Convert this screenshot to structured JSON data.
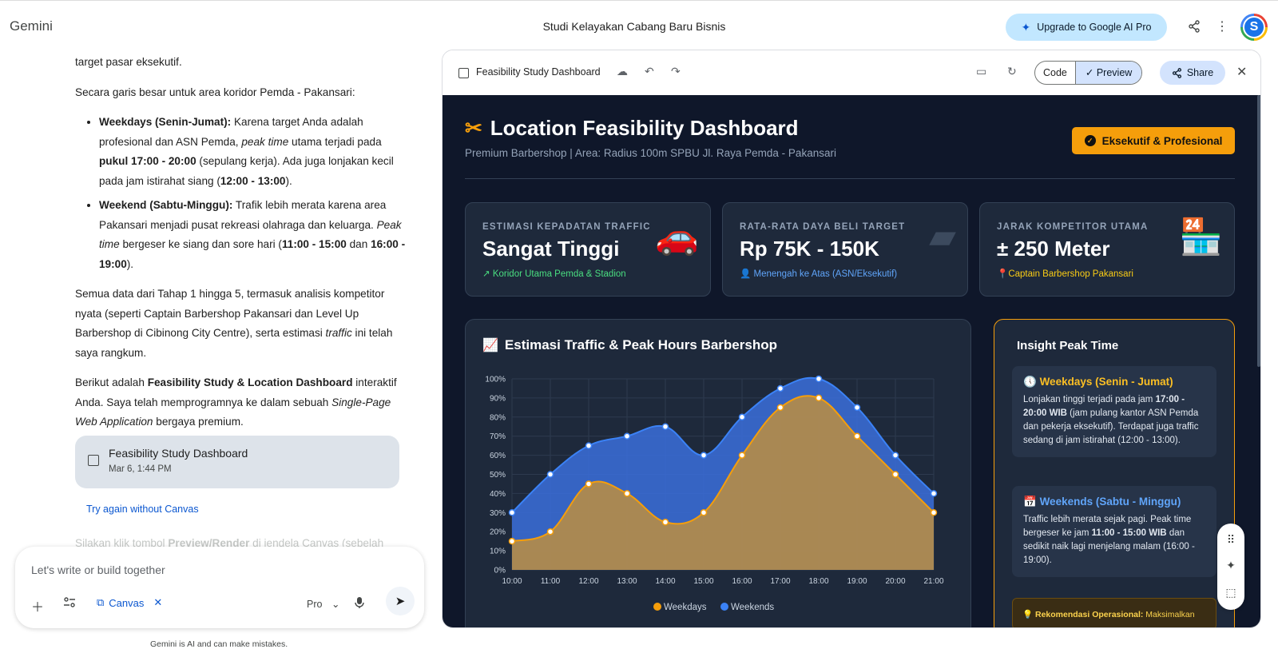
{
  "app": {
    "name": "Gemini",
    "conversation_title": "Studi Kelayakan Cabang Baru Bisnis",
    "upgrade_label": "Upgrade to Google AI Pro",
    "avatar_letter": "S"
  },
  "chat": {
    "p0": "target pasar eksekutif.",
    "p1": "Secara garis besar untuk area koridor Pemda - Pakansari:",
    "b1": {
      "title": "Weekdays (Senin-Jumat):",
      "t1": " Karena target Anda adalah profesional dan ASN Pemda, ",
      "i1": "peak time",
      "t2": " utama terjadi pada ",
      "b": "pukul 17:00 - 20:00",
      "t3": " (sepulang kerja). Ada juga lonjakan kecil pada jam istirahat siang (",
      "b2": "12:00 - 13:00",
      "t4": ")."
    },
    "b2": {
      "title": "Weekend (Sabtu-Minggu):",
      "t1": " Trafik lebih merata karena area Pakansari menjadi pusat rekreasi olahraga dan keluarga. ",
      "i1": "Peak time",
      "t2": " bergeser ke siang dan sore hari (",
      "b": "11:00 - 15:00",
      "t3": " dan ",
      "b2": "16:00 - 19:00",
      "t4": ")."
    },
    "p2": {
      "t1": "Semua data dari Tahap 1 hingga 5, termasuk analisis kompetitor nyata (seperti Captain Barbershop Pakansari dan Level Up Barbershop di Cibinong City Centre), serta estimasi ",
      "i": "traffic",
      "t2": " ini telah saya rangkum."
    },
    "p3": {
      "t1": "Berikut adalah ",
      "b": "Feasibility Study & Location Dashboard",
      "t2": " interaktif Anda. Saya telah memprogramnya ke dalam sebuah ",
      "i": "Single-Page Web Application",
      "t3": " bergaya premium."
    },
    "card_title": "Feasibility Study Dashboard",
    "card_date": "Mar 6, 1:44 PM",
    "try_again": "Try again without Canvas",
    "faded": {
      "t1": "Silakan klik tombol ",
      "b": "Preview/Render",
      "t2": " di jendela Canvas (sebelah"
    }
  },
  "composer": {
    "placeholder": "Let's write or build together",
    "canvas_chip": "Canvas",
    "model": "Pro",
    "disclaimer": "Gemini is AI and can make mistakes."
  },
  "panel": {
    "title": "Feasibility Study Dashboard",
    "code_label": "Code",
    "preview_label": "Preview",
    "share_label": "Share"
  },
  "dashboard": {
    "title": "Location Feasibility Dashboard",
    "subtitle": "Premium Barbershop | Area: Radius 100m SPBU Jl. Raya Pemda - Pakansari",
    "badge": "Eksekutif & Profesional",
    "kpis": [
      {
        "label": "ESTIMASI KEPADATAN TRAFFIC",
        "value": "Sangat Tinggi",
        "sub": "Koridor Utama Pemda & Stadion",
        "sub_color": "#4ade80",
        "icon": "car-icon"
      },
      {
        "label": "RATA-RATA DAYA BELI TARGET",
        "value": "Rp 75K - 150K",
        "sub": "Menengah ke Atas (ASN/Eksekutif)",
        "sub_color": "#60a5fa",
        "icon": "wallet-icon"
      },
      {
        "label": "JARAK KOMPETITOR UTAMA",
        "value": "± 250 Meter",
        "sub": "Captain Barbershop Pakansari",
        "sub_color": "#facc15",
        "icon": "store-icon"
      }
    ],
    "chart_title": "Estimasi Traffic & Peak Hours Barbershop",
    "insight": {
      "title": "Insight Peak Time",
      "weekdays": {
        "head": "Weekdays (Senin - Jumat)",
        "t1": "Lonjakan tinggi terjadi pada jam ",
        "b": "17:00 - 20:00 WIB",
        "t2": " (jam pulang kantor ASN Pemda dan pekerja eksekutif). Terdapat juga traffic sedang di jam istirahat (12:00 - 13:00)."
      },
      "weekends": {
        "head": "Weekends (Sabtu - Minggu)",
        "t1": "Traffic lebih merata sejak pagi. Peak time bergeser ke jam ",
        "b": "11:00 - 15:00 WIB",
        "t2": " dan sedikit naik lagi menjelang malam (16:00 - 19:00)."
      },
      "rec_label": "Rekomendasi Operasional:",
      "rec_text": " Maksimalkan"
    }
  },
  "chart_data": {
    "type": "area",
    "x": [
      "10:00",
      "11:00",
      "12:00",
      "13:00",
      "14:00",
      "15:00",
      "16:00",
      "17:00",
      "18:00",
      "19:00",
      "20:00",
      "21:00"
    ],
    "series": [
      {
        "name": "Weekdays",
        "values": [
          15,
          20,
          45,
          40,
          25,
          30,
          60,
          85,
          90,
          70,
          50,
          30
        ],
        "color": "#f59e0b"
      },
      {
        "name": "Weekends",
        "values": [
          30,
          50,
          65,
          70,
          75,
          60,
          80,
          95,
          100,
          85,
          60,
          40
        ],
        "color": "#3b82f6"
      }
    ],
    "ylim": [
      0,
      100
    ],
    "yticks": [
      "0%",
      "10%",
      "20%",
      "30%",
      "40%",
      "50%",
      "60%",
      "70%",
      "80%",
      "90%",
      "100%"
    ],
    "grid": true,
    "legend": "bottom"
  }
}
